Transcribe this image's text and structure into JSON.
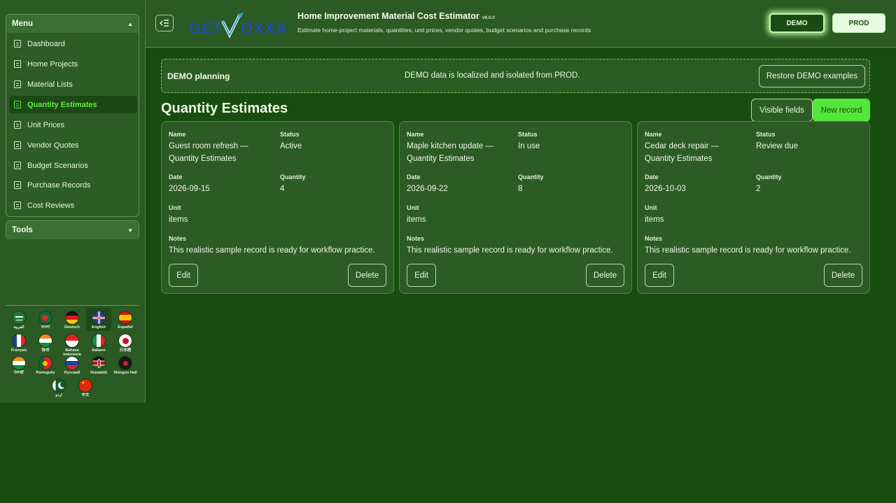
{
  "sidebar": {
    "menu_title": "Menu",
    "tools_title": "Tools",
    "items": [
      {
        "label": "Dashboard"
      },
      {
        "label": "Home Projects"
      },
      {
        "label": "Material Lists"
      },
      {
        "label": "Quantity Estimates",
        "active": true
      },
      {
        "label": "Unit Prices"
      },
      {
        "label": "Vendor Quotes"
      },
      {
        "label": "Budget Scenarios"
      },
      {
        "label": "Purchase Records"
      },
      {
        "label": "Cost Reviews"
      }
    ],
    "languages": [
      {
        "label": "العربية",
        "icon": "flag-saudi-icon"
      },
      {
        "label": "বাংলা",
        "icon": "flag-bangladesh-icon"
      },
      {
        "label": "Deutsch",
        "icon": "flag-germany-icon"
      },
      {
        "label": "English",
        "icon": "flag-uk-icon",
        "selected": true
      },
      {
        "label": "Español",
        "icon": "flag-spain-icon"
      },
      {
        "label": "Français",
        "icon": "flag-france-icon"
      },
      {
        "label": "हिन्दी",
        "icon": "flag-india-icon"
      },
      {
        "label": "Bahasa Indonesia",
        "icon": "flag-indonesia-icon"
      },
      {
        "label": "Italiano",
        "icon": "flag-italy-icon"
      },
      {
        "label": "日本語",
        "icon": "flag-japan-icon"
      },
      {
        "label": "ਪੰਜਾਬੀ",
        "icon": "flag-india-punjabi-icon"
      },
      {
        "label": "Português",
        "icon": "flag-portugal-icon"
      },
      {
        "label": "Русский",
        "icon": "flag-russia-icon"
      },
      {
        "label": "Kiswahili",
        "icon": "flag-kenya-icon"
      },
      {
        "label": "Shingon Hall",
        "icon": "flag-shingon-icon"
      },
      {
        "label": "اردو",
        "icon": "flag-pakistan-icon"
      },
      {
        "label": "中文",
        "icon": "flag-china-icon"
      }
    ]
  },
  "header": {
    "logo_text": "GETVOXXA",
    "title": "Home Improvement Material Cost Estimator",
    "version": "v9.0.0",
    "subtitle": "Estimate home-project materials, quantities, unit prices, vendor quotes, budget scenarios and purchase records",
    "demo_label": "DEMO",
    "prod_label": "PROD"
  },
  "banner": {
    "title": "DEMO planning",
    "message": "DEMO data is localized and isolated from PROD.",
    "restore_label": "Restore DEMO examples"
  },
  "main": {
    "title": "Quantity Estimates",
    "visible_fields_label": "Visible fields",
    "new_record_label": "New record"
  },
  "labels": {
    "name": "Name",
    "status": "Status",
    "date": "Date",
    "quantity": "Quantity",
    "unit": "Unit",
    "notes": "Notes",
    "edit": "Edit",
    "delete": "Delete"
  },
  "records": [
    {
      "name": "Guest room refresh — Quantity Estimates",
      "status": "Active",
      "date": "2026-09-15",
      "quantity": "4",
      "unit": "items",
      "notes": "This realistic sample record is ready for workflow practice."
    },
    {
      "name": "Maple kitchen update — Quantity Estimates",
      "status": "In use",
      "date": "2026-09-22",
      "quantity": "8",
      "unit": "items",
      "notes": "This realistic sample record is ready for workflow practice."
    },
    {
      "name": "Cedar deck repair — Quantity Estimates",
      "status": "Review due",
      "date": "2026-10-03",
      "quantity": "2",
      "unit": "items",
      "notes": "This realistic sample record is ready for workflow practice."
    }
  ],
  "colors": {
    "background": "#174e0f",
    "panel": "#2b5a24",
    "accent": "#54e63a",
    "active_text": "#5cf03c"
  }
}
